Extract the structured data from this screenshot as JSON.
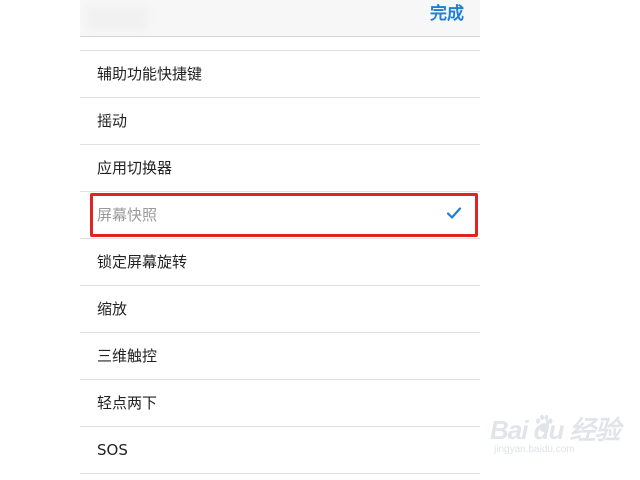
{
  "navbar": {
    "done_label": "完成"
  },
  "list": {
    "items": [
      {
        "label": "辅助功能快捷键",
        "selected": false
      },
      {
        "label": "摇动",
        "selected": false
      },
      {
        "label": "应用切换器",
        "selected": false
      },
      {
        "label": "屏幕快照",
        "selected": true
      },
      {
        "label": "锁定屏幕旋转",
        "selected": false
      },
      {
        "label": "缩放",
        "selected": false
      },
      {
        "label": "三维触控",
        "selected": false
      },
      {
        "label": "轻点两下",
        "selected": false
      },
      {
        "label": "SOS",
        "selected": false
      }
    ]
  },
  "watermark": {
    "brand": "Bai du 经验",
    "url": "jingyan.baidu.com"
  },
  "icons": {
    "check": "checkmark-icon",
    "paw": "baidu-paw-icon"
  },
  "colors": {
    "accent": "#1e7fd6",
    "highlight": "#e02422",
    "selected_text": "#9a9a9a"
  }
}
